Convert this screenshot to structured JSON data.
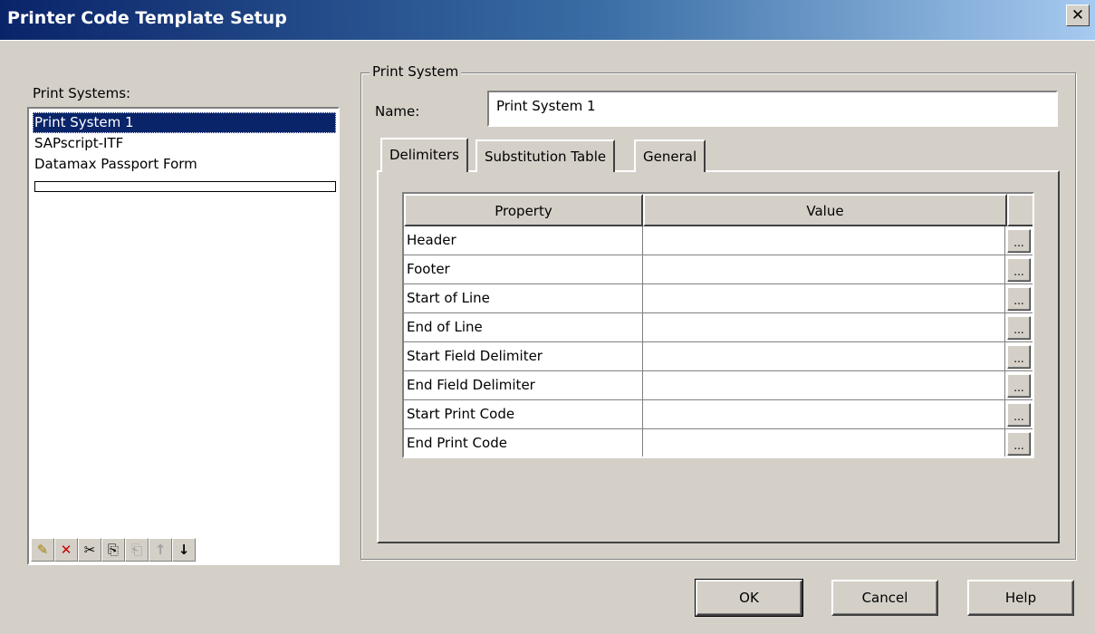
{
  "window": {
    "title": "Printer Code Template Setup",
    "close_glyph": "✕"
  },
  "print_systems": {
    "label": "Print Systems:",
    "items": [
      "Print System 1",
      "SAPscript-ITF",
      "Datamax Passport Form"
    ],
    "selected_index": 0
  },
  "toolbar": {
    "icons": [
      "new-icon",
      "delete-icon",
      "cut-icon",
      "copy-icon",
      "paste-icon",
      "move-up-icon",
      "move-down-icon"
    ],
    "glyphs": [
      "✎",
      "✕",
      "✂",
      "⎘",
      "⎗",
      "↑",
      "↓"
    ]
  },
  "print_system": {
    "group_label": "Print System",
    "name_label": "Name:",
    "name_value": "Print System 1"
  },
  "tabs": [
    "Delimiters",
    "Substitution Table",
    "General"
  ],
  "active_tab": 0,
  "grid": {
    "headers": [
      "Property",
      "Value"
    ],
    "rows": [
      {
        "property": "Header",
        "value": ""
      },
      {
        "property": "Footer",
        "value": ""
      },
      {
        "property": "Start of Line",
        "value": ""
      },
      {
        "property": "End of Line",
        "value": ""
      },
      {
        "property": "Start Field Delimiter",
        "value": ""
      },
      {
        "property": "End Field Delimiter",
        "value": ""
      },
      {
        "property": "Start Print Code",
        "value": ""
      },
      {
        "property": "End Print Code",
        "value": ""
      }
    ],
    "ellipsis": "..."
  },
  "buttons": {
    "ok": "OK",
    "cancel": "Cancel",
    "help": "Help"
  },
  "colors": {
    "titlebar_start": "#0a246a",
    "titlebar_end": "#a6caf0",
    "face": "#d4d0c8",
    "selection": "#0a246a",
    "delete_red": "#cc0000"
  }
}
